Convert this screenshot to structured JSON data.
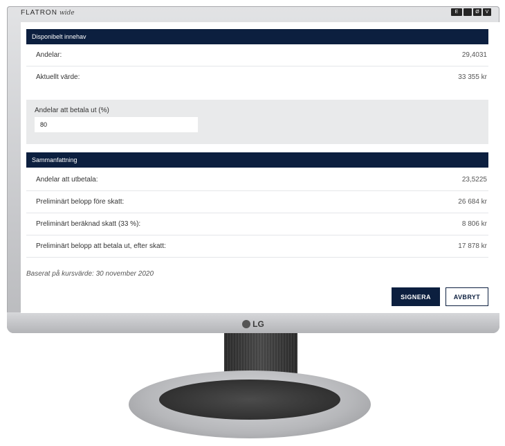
{
  "monitor": {
    "brand": "FLATRON",
    "brand_sub": "wide",
    "logo_text": "LG",
    "badges": [
      "E",
      "",
      "Ø",
      "V"
    ]
  },
  "holdings": {
    "title": "Disponibelt innehav",
    "rows": [
      {
        "label": "Andelar:",
        "value": "29,4031"
      },
      {
        "label": "Aktuellt värde:",
        "value": "33 355 kr"
      }
    ]
  },
  "payout_input": {
    "label": "Andelar att betala ut (%)",
    "value": "80"
  },
  "summary": {
    "title": "Sammanfattning",
    "rows": [
      {
        "label": "Andelar att utbetala:",
        "value": "23,5225"
      },
      {
        "label": "Preliminärt belopp före skatt:",
        "value": "26 684 kr"
      },
      {
        "label": "Preliminärt beräknad skatt (33 %):",
        "value": "8 806 kr"
      },
      {
        "label": "Preliminärt belopp att betala ut, efter skatt:",
        "value": "17 878 kr"
      }
    ]
  },
  "note": "Baserat på kursvärde: 30 november 2020",
  "actions": {
    "sign_label": "SIGNERA",
    "cancel_label": "AVBRYT"
  },
  "colors": {
    "header_bg": "#0c1f3f",
    "panel_bg": "#e9eaeb"
  }
}
